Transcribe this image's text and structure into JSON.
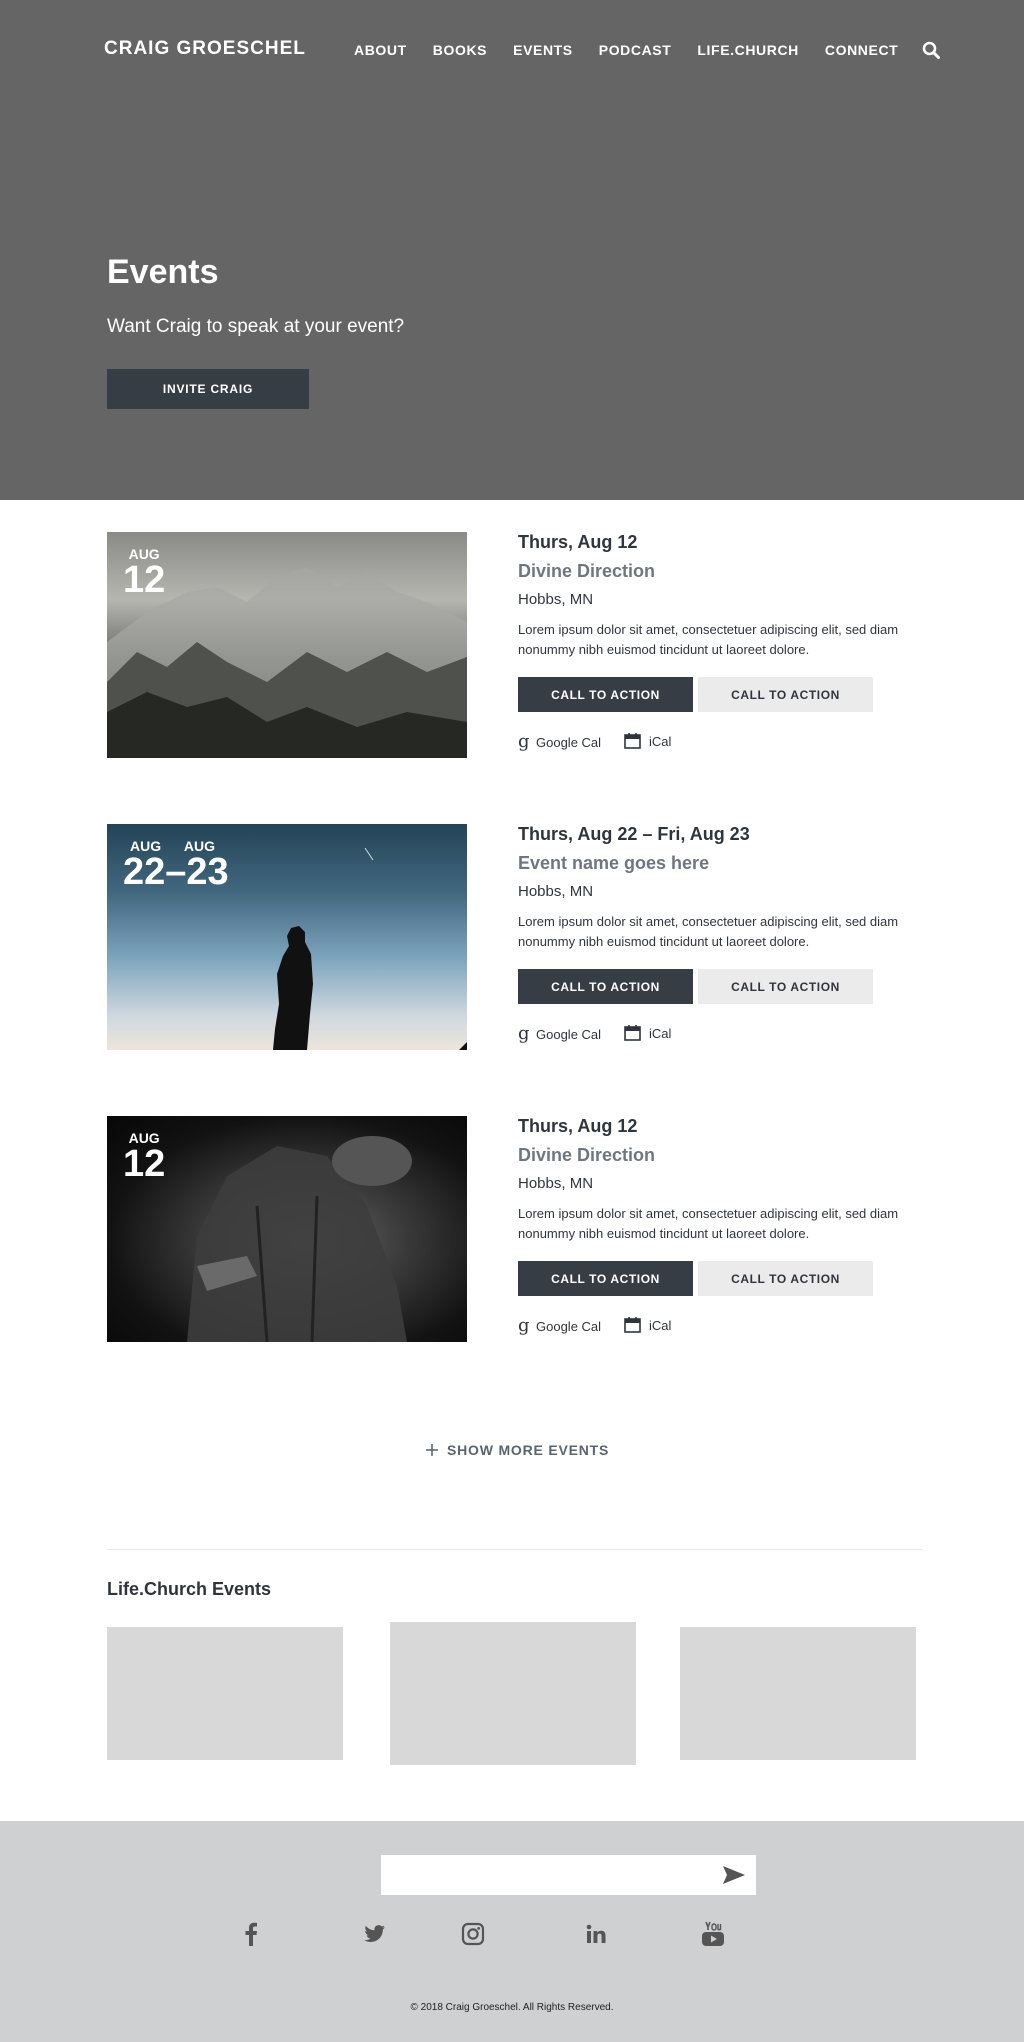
{
  "header": {
    "logo": "CRAIG GROESCHEL",
    "nav": [
      "ABOUT",
      "BOOKS",
      "EVENTS",
      "PODCAST",
      "LIFE.CHURCH",
      "CONNECT"
    ]
  },
  "hero": {
    "title": "Events",
    "subtitle": "Want Craig to speak at your event?",
    "button": "INVITE CRAIG"
  },
  "events": [
    {
      "month": "AUG",
      "day": "12",
      "date_text": "Thurs, Aug 12",
      "name": "Divine Direction",
      "location": "Hobbs, MN",
      "description": "Lorem ipsum dolor sit amet, consectetuer adipiscing elit, sed diam nonummy nibh euismod tincidunt ut laoreet dolore.",
      "cta_primary": "CALL TO ACTION",
      "cta_secondary": "CALL TO ACTION",
      "google_cal": "Google Cal",
      "ical": "iCal"
    },
    {
      "month": "AUG",
      "month_end": "AUG",
      "day": "22–23",
      "date_text": "Thurs, Aug 22 – Fri, Aug 23",
      "name": "Event name goes here",
      "location": "Hobbs, MN",
      "description": "Lorem ipsum dolor sit amet, consectetuer adipiscing elit, sed diam nonummy nibh euismod tincidunt ut laoreet dolore.",
      "cta_primary": "CALL TO ACTION",
      "cta_secondary": "CALL TO ACTION",
      "google_cal": "Google Cal",
      "ical": "iCal"
    },
    {
      "month": "AUG",
      "day": "12",
      "date_text": "Thurs, Aug 12",
      "name": "Divine Direction",
      "location": "Hobbs, MN",
      "description": "Lorem ipsum dolor sit amet, consectetuer adipiscing elit, sed diam nonummy nibh euismod tincidunt ut laoreet dolore.",
      "cta_primary": "CALL TO ACTION",
      "cta_secondary": "CALL TO ACTION",
      "google_cal": "Google Cal",
      "ical": "iCal"
    }
  ],
  "show_more": "SHOW MORE EVENTS",
  "lifechurch": {
    "title": "Life.Church Events"
  },
  "footer": {
    "social": [
      "facebook-icon",
      "twitter-icon",
      "instagram-icon",
      "linkedin-icon",
      "youtube-icon"
    ],
    "copyright": "© 2018 Craig Groeschel. All Rights Reserved."
  },
  "colors": {
    "hero_bg": "#656565",
    "button_dark": "#363d45",
    "button_light": "#ebebeb",
    "footer_bg": "#cfd0d2",
    "placeholder": "#d8d8d8"
  }
}
